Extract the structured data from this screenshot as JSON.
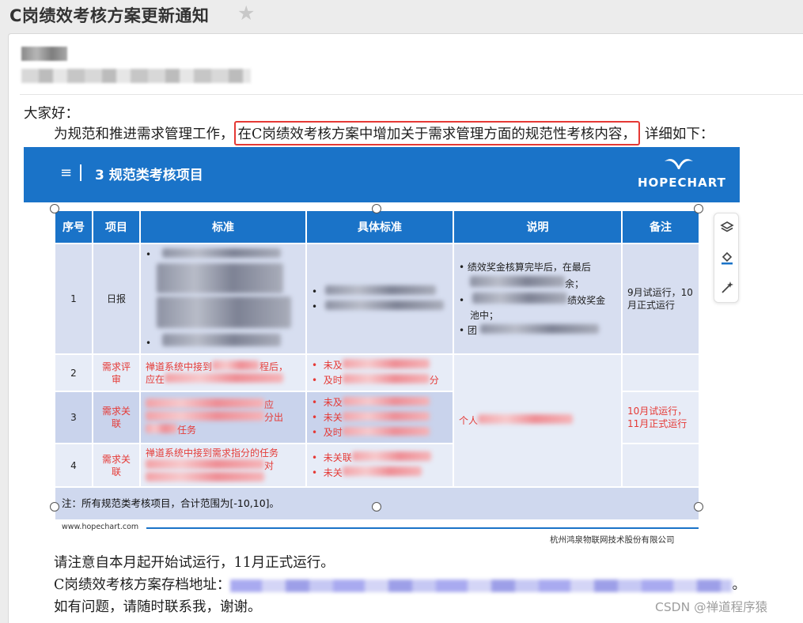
{
  "title": "C岗绩效考核方案更新通知",
  "icons": {
    "star": "star-icon",
    "menu": "hamburger-icon",
    "layers": "layers-icon",
    "paint": "paint-bucket-icon",
    "magic": "magic-wand-icon",
    "bird": "seagull-logo-icon"
  },
  "colors": {
    "accent": "#1a73c8",
    "highlight_border": "#e53935",
    "red_text": "#e53935"
  },
  "body": {
    "greeting": "大家好：",
    "intro_prefix": "为规范和推进需求管理工作，",
    "intro_highlight": "在C岗绩效考核方案中增加关于需求管理方面的规范性考核内容，",
    "intro_suffix": "详细如下：",
    "notice": "请注意自本月起开始试运行，11月正式运行。",
    "archive_label": "C岗绩效考核方案存档地址：",
    "archive_end": "。",
    "contact": "如有问题，请随时联系我，谢谢。"
  },
  "slide": {
    "menu_glyph": "≡",
    "section_title": "3  规范类考核项目",
    "logo": "HOPECHART",
    "headers": [
      "序号",
      "项目",
      "标准",
      "具体标准",
      "说明",
      "备注"
    ],
    "rows": [
      {
        "no": "1",
        "item": "日报",
        "remark": "9月试运行，10月正式运行",
        "desc_frag": [
          "绩效奖金核算完毕后，在最后",
          "余；",
          "绩效奖金",
          "池中；",
          "团"
        ]
      },
      {
        "no": "2",
        "item": "需求评审",
        "std_frag": "禅道系统中接到",
        "std_frag2": "程后，",
        "std_frag3": "应在",
        "spec": [
          "未及",
          "及时"
        ],
        "spec_suffix": "分"
      },
      {
        "no": "3",
        "item": "需求关联",
        "std_frag": "应",
        "std_frag2": "分出",
        "std_frag3": "任务",
        "spec": [
          "未及",
          "未关",
          "及时"
        ],
        "desc": "个人",
        "remark": "10月试运行，11月正式运行"
      },
      {
        "no": "4",
        "item": "需求关联",
        "std_frag": "禅道系统中接到需求指分的任务",
        "std_frag2": "对",
        "spec": [
          "未关联",
          "未关"
        ]
      }
    ],
    "note": "注：所有规范类考核项目，合计范围为[-10,10]。",
    "footer_url": "www.hopechart.com",
    "footer_company": "杭州鸿泉物联网技术股份有限公司"
  },
  "watermark": "CSDN @禅道程序猿"
}
